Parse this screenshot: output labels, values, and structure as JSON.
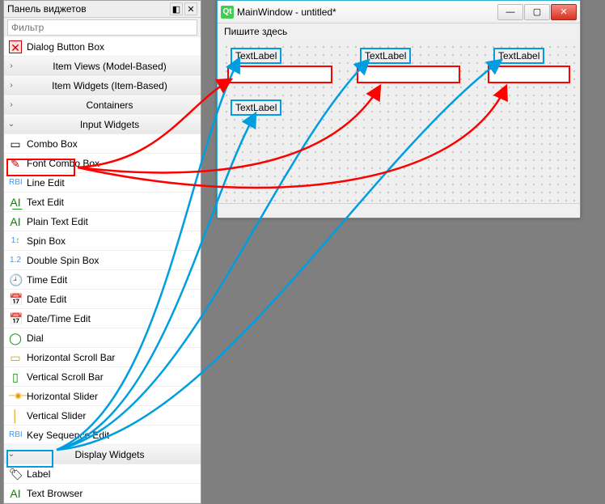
{
  "panel": {
    "title": "Панель виджетов",
    "dock_icon": "window-dock-icon",
    "close_icon": "close-icon",
    "filter_placeholder": "Фильтр"
  },
  "tree": {
    "categories": [
      {
        "label": "Dialog Button Box",
        "chev": "✕",
        "is_delete_style": true
      },
      {
        "label": "Item Views (Model-Based)",
        "chev": "›"
      },
      {
        "label": "Item Widgets (Item-Based)",
        "chev": "›"
      },
      {
        "label": "Containers",
        "chev": "›"
      },
      {
        "label": "Input Widgets",
        "chev": "⌄"
      }
    ],
    "input_widgets": [
      {
        "label": "Combo Box",
        "icon": "combobox-icon"
      },
      {
        "label": "Font Combo Box",
        "icon": "fontcombo-icon"
      },
      {
        "label": "Line Edit",
        "icon": "lineedit-icon",
        "highlight": "red"
      },
      {
        "label": "Text Edit",
        "icon": "textedit-icon"
      },
      {
        "label": "Plain Text Edit",
        "icon": "plaintext-icon"
      },
      {
        "label": "Spin Box",
        "icon": "spinbox-icon"
      },
      {
        "label": "Double Spin Box",
        "icon": "doublespin-icon"
      },
      {
        "label": "Time Edit",
        "icon": "timeedit-icon"
      },
      {
        "label": "Date Edit",
        "icon": "dateedit-icon"
      },
      {
        "label": "Date/Time Edit",
        "icon": "datetime-icon"
      },
      {
        "label": "Dial",
        "icon": "dial-icon"
      },
      {
        "label": "Horizontal Scroll Bar",
        "icon": "hscroll-icon"
      },
      {
        "label": "Vertical Scroll Bar",
        "icon": "vscroll-icon"
      },
      {
        "label": "Horizontal Slider",
        "icon": "hslider-icon"
      },
      {
        "label": "Vertical Slider",
        "icon": "vslider-icon"
      },
      {
        "label": "Key Sequence Edit",
        "icon": "keyseq-icon"
      }
    ],
    "display_cat": {
      "label": "Display Widgets",
      "chev": "⌄"
    },
    "display_widgets": [
      {
        "label": "Label",
        "icon": "label-icon",
        "highlight": "blue"
      },
      {
        "label": "Text Browser",
        "icon": "textbrowser-icon"
      }
    ]
  },
  "mainwin": {
    "title": "MainWindow - untitled*",
    "menu_placeholder": "Пишите здесь",
    "labels": [
      {
        "text": "TextLabel"
      },
      {
        "text": "TextLabel"
      },
      {
        "text": "TextLabel"
      },
      {
        "text": "TextLabel"
      }
    ]
  },
  "icons": {
    "combobox-icon": "▭",
    "fontcombo-icon": "✎",
    "lineedit-icon": "▭",
    "textedit-icon": "A̲I̲",
    "plaintext-icon": "AI",
    "spinbox-icon": "1↕",
    "doublespin-icon": "1.2",
    "timeedit-icon": "🕘",
    "dateedit-icon": "📅",
    "datetime-icon": "📅",
    "dial-icon": "◯",
    "hscroll-icon": "▭",
    "vscroll-icon": "▯",
    "hslider-icon": "─⊙─",
    "vslider-icon": "│",
    "keyseq-icon": "▭",
    "label-icon": "🏷",
    "textbrowser-icon": "AI"
  }
}
